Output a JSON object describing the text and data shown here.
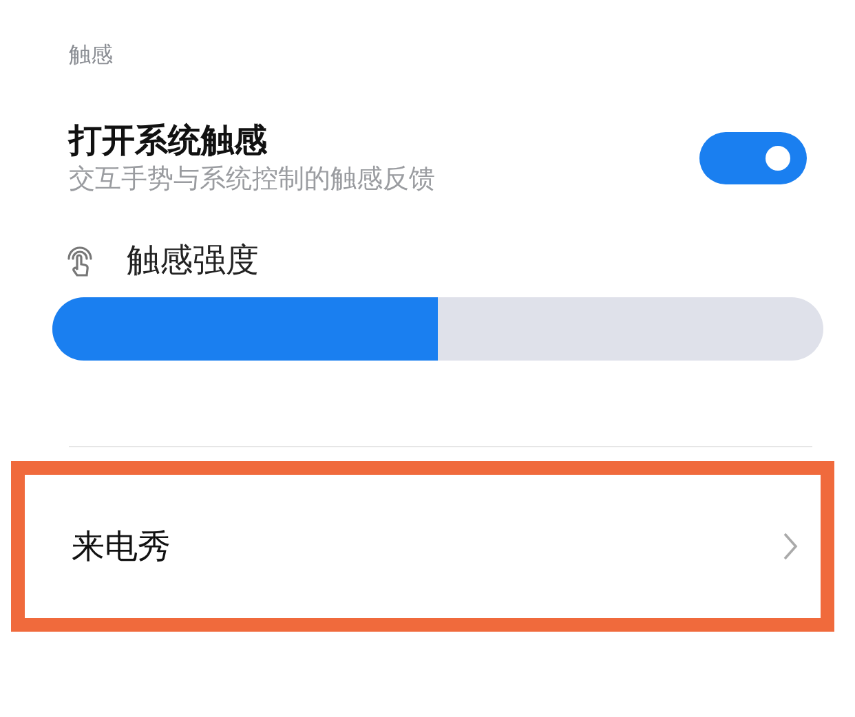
{
  "section_header": "触感",
  "toggle": {
    "title": "打开系统触感",
    "subtitle": "交互手势与系统控制的触感反馈",
    "on": true
  },
  "intensity": {
    "label": "触感强度",
    "level": 0.5
  },
  "rows": [
    {
      "label": "来电秀",
      "highlighted": true
    }
  ]
}
